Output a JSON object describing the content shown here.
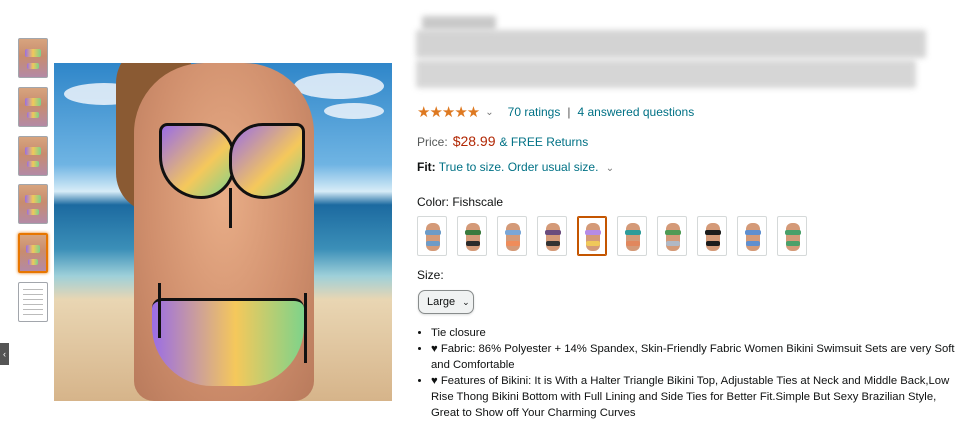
{
  "thumbnails": [
    {
      "kind": "photo",
      "selected": false
    },
    {
      "kind": "photo",
      "selected": false
    },
    {
      "kind": "photo",
      "selected": false
    },
    {
      "kind": "photo",
      "selected": false
    },
    {
      "kind": "photo",
      "selected": true
    },
    {
      "kind": "size-chart",
      "selected": false
    }
  ],
  "rating": {
    "stars": 4.5,
    "star_glyphs": "★★★★★",
    "chevron": "⌄",
    "ratings_text": "70 ratings",
    "separator": "|",
    "questions_text": "4 answered questions"
  },
  "price": {
    "label": "Price:",
    "value": "$28.99",
    "shipping": "& FREE Returns"
  },
  "fit": {
    "label": "Fit:",
    "value": "True to size. Order usual size.",
    "chevron": "⌄"
  },
  "color": {
    "label": "Color: Fishscale",
    "swatches": [
      {
        "top": "#6d9bc7",
        "bottom": "#6d9bc7",
        "selected": false
      },
      {
        "top": "#3a7a3e",
        "bottom": "#2b2b2b",
        "selected": false
      },
      {
        "top": "#7aa6d6",
        "bottom": "#ef8c5a",
        "selected": false
      },
      {
        "top": "#6a4c7d",
        "bottom": "#333333",
        "selected": false
      },
      {
        "top": "#b58be6",
        "bottom": "#f0c85a",
        "selected": true
      },
      {
        "top": "#2f9c9a",
        "bottom": "#e1875d",
        "selected": false
      },
      {
        "top": "#4f9a55",
        "bottom": "#b0b8c5",
        "selected": false
      },
      {
        "top": "#1c1c1c",
        "bottom": "#1c1c1c",
        "selected": false
      },
      {
        "top": "#5f8fcf",
        "bottom": "#5f8fcf",
        "selected": false
      },
      {
        "top": "#4aa06a",
        "bottom": "#4aa06a",
        "selected": false
      }
    ]
  },
  "size": {
    "label": "Size:",
    "selected": "Large",
    "chevron": "⌄"
  },
  "bullets": [
    "Tie closure",
    "♥ Fabric: 86% Polyester + 14% Spandex, Skin-Friendly Fabric Women Bikini Swimsuit Sets are very Soft and Comfortable",
    "♥ Features of Bikini: It is With a Halter Triangle Bikini Top, Adjustable Ties at Neck and Middle Back,Low Rise Thong Bikini Bottom with Full Lining and Side Ties for Better Fit.Simple But Sexy Brazilian Style, Great to Show off Your Charming Curves"
  ],
  "side_arrow": "‹"
}
